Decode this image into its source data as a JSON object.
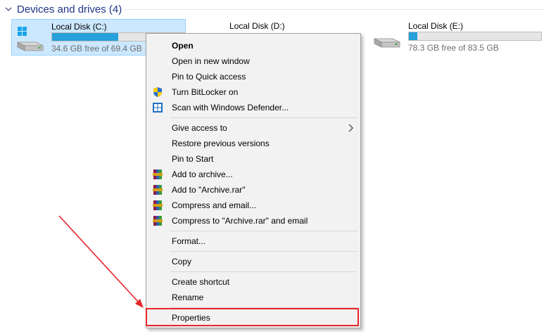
{
  "group": {
    "title": "Devices and drives (4)"
  },
  "drives": [
    {
      "name": "Local Disk (C:)",
      "free": "34.6 GB free of 69.4 GB",
      "used_fraction": 0.5,
      "os_drive": true
    },
    {
      "name": "Local Disk (D:)",
      "free": "",
      "used_fraction": 0.0,
      "os_drive": false
    },
    {
      "name": "Local Disk (E:)",
      "free": "78.3 GB free of 83.5 GB",
      "used_fraction": 0.063,
      "os_drive": false
    }
  ],
  "menu": {
    "items": [
      {
        "label": "Open",
        "bold": true,
        "icon": ""
      },
      {
        "label": "Open in new window",
        "icon": ""
      },
      {
        "label": "Pin to Quick access",
        "icon": ""
      },
      {
        "label": "Turn BitLocker on",
        "icon": "uac-shield-icon"
      },
      {
        "label": "Scan with Windows Defender...",
        "icon": "windows-defender-icon"
      },
      {
        "label": "Give access to",
        "icon": "",
        "submenu": true
      },
      {
        "label": "Restore previous versions",
        "icon": ""
      },
      {
        "label": "Pin to Start",
        "icon": ""
      },
      {
        "label": "Add to archive...",
        "icon": "winrar-icon"
      },
      {
        "label": "Add to \"Archive.rar\"",
        "icon": "winrar-icon"
      },
      {
        "label": "Compress and email...",
        "icon": "winrar-icon"
      },
      {
        "label": "Compress to \"Archive.rar\" and email",
        "icon": "winrar-icon"
      },
      {
        "label": "Format...",
        "icon": ""
      },
      {
        "label": "Copy",
        "icon": ""
      },
      {
        "label": "Create shortcut",
        "icon": ""
      },
      {
        "label": "Rename",
        "icon": ""
      },
      {
        "label": "Properties",
        "icon": ""
      }
    ]
  },
  "colors": {
    "selection_bg": "#cce8ff",
    "capacity_fill": "#26a0da",
    "annotation_red": "#e8262a",
    "header_blue": "#1e3287"
  }
}
